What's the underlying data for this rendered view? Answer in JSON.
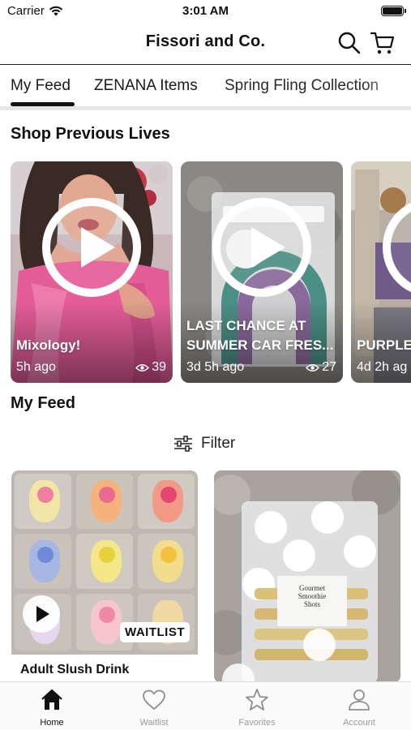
{
  "status_bar": {
    "carrier": "Carrier",
    "time": "3:01 AM",
    "battery_level": 1.0
  },
  "header": {
    "title": "Fissori and Co.",
    "search_icon": "search-icon",
    "cart_icon": "cart-icon"
  },
  "tabs": [
    {
      "label": "My Feed",
      "selected": true
    },
    {
      "label": "ZENANA Items",
      "selected": false
    },
    {
      "label": "Spring Fling Collection",
      "selected": false
    }
  ],
  "lives": {
    "title": "Shop Previous Lives",
    "items": [
      {
        "title": "Mixology!",
        "age": "5h ago",
        "views": "39"
      },
      {
        "title": "LAST CHANCE AT SUMMER CAR FRES...",
        "age": "3d 5h ago",
        "views": "27"
      },
      {
        "title": "PURPLE",
        "age": "4d 2h ag",
        "views": ""
      }
    ]
  },
  "feed": {
    "title": "My Feed",
    "filter_label": "Filter",
    "items": [
      {
        "title": "Adult Slush Drink",
        "badge": "WAITLIST",
        "has_video": true
      },
      {
        "title": "",
        "label_line1": "Gourmet",
        "label_line2": "Smoothie",
        "label_line3": "Shots",
        "has_video": true
      }
    ]
  },
  "tabbar": [
    {
      "label": "Home",
      "icon": "home-icon",
      "active": true
    },
    {
      "label": "Waitlist",
      "icon": "heart-icon",
      "active": false
    },
    {
      "label": "Favorites",
      "icon": "star-icon",
      "active": false
    },
    {
      "label": "Account",
      "icon": "person-icon",
      "active": false
    }
  ],
  "colors": {
    "accent": "#111111",
    "inactive": "#9a9a9a",
    "separator": "#e6e6e6"
  }
}
